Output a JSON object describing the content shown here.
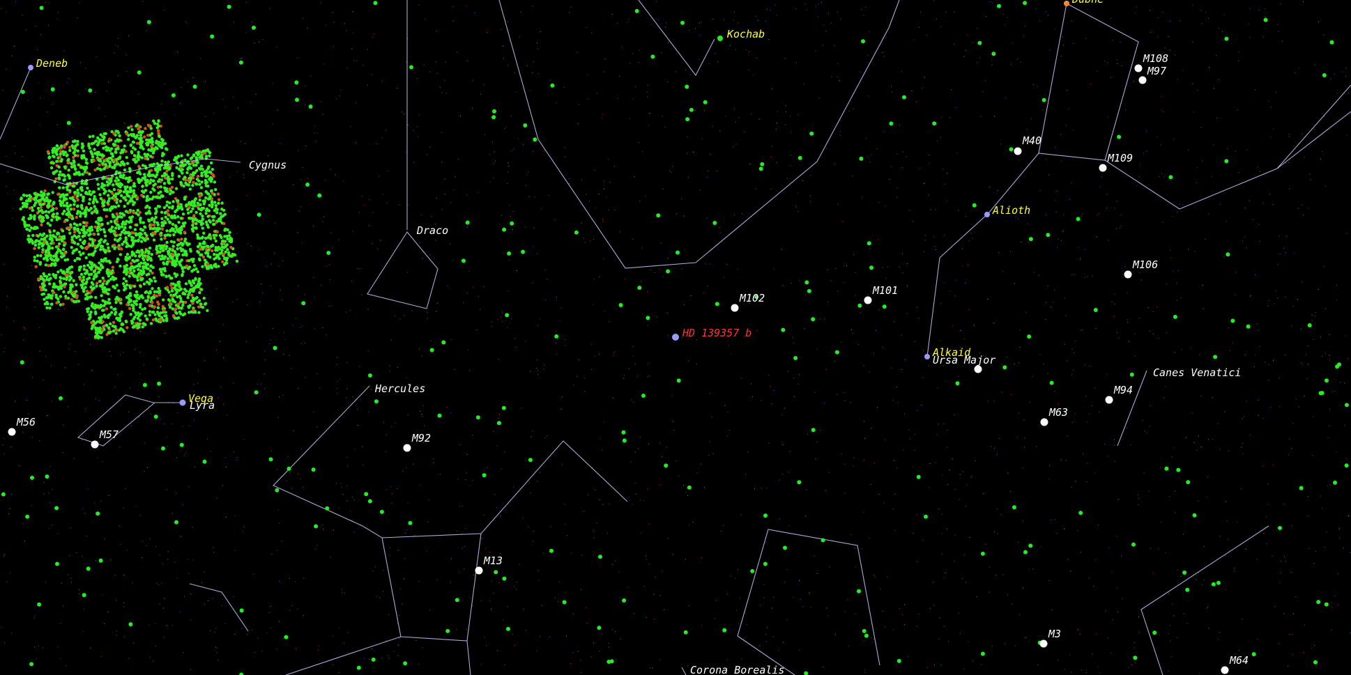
{
  "colors": {
    "background": "#000000",
    "constellation_line": "#c8c8ff",
    "constellation_label": "#ffffff",
    "star_label": "#ffff33",
    "target_label": "#ff3333",
    "green_star": "#22ee22",
    "messier": "#ffffff"
  },
  "constellations": {
    "cygnus": "Cygnus",
    "draco": "Draco",
    "hercules": "Hercules",
    "lyra": "Lyra",
    "ursa_major": "Ursa Major",
    "canes_venatici": "Canes Venatici",
    "corona_borealis": "Corona Borealis"
  },
  "stars": {
    "deneb": "Deneb",
    "vega": "Vega",
    "kochab": "Kochab",
    "alioth": "Alioth",
    "alkaid": "Alkaid",
    "dubhe": "Dubhe"
  },
  "target": {
    "name": "HD 139357 b"
  },
  "messier": {
    "m108": "M108",
    "m97": "M97",
    "m40": "M40",
    "m109": "M109",
    "m106": "M106",
    "m102": "M102",
    "m101": "M101",
    "m94": "M94",
    "m63": "M63",
    "m56": "M56",
    "m57": "M57",
    "m92": "M92",
    "m13": "M13",
    "m3": "M3",
    "m64": "M64"
  }
}
